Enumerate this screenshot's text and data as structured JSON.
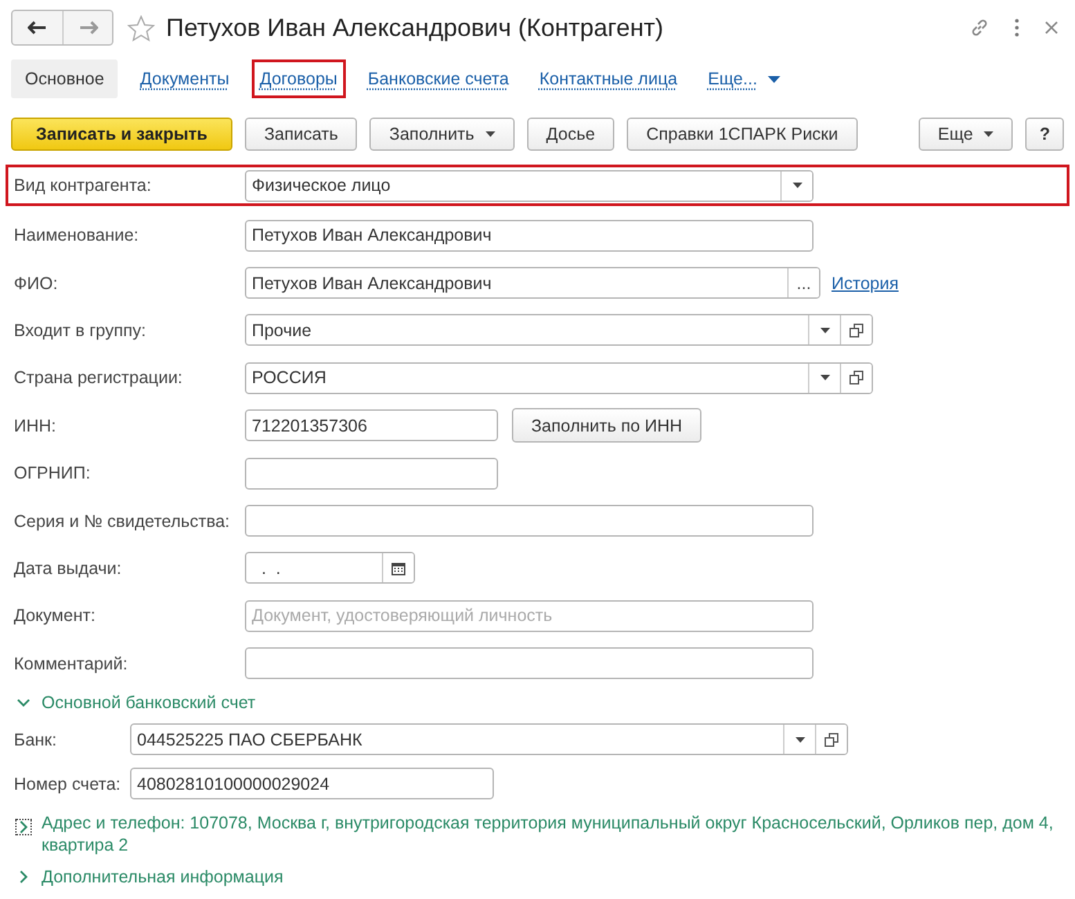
{
  "window": {
    "title": "Петухов Иван Александрович (Контрагент)"
  },
  "tabs": [
    {
      "label": "Основное",
      "selected": true,
      "highlighted": false,
      "kind": "tab"
    },
    {
      "label": "Документы",
      "selected": false,
      "highlighted": false,
      "kind": "tab"
    },
    {
      "label": "Договоры",
      "selected": false,
      "highlighted": true,
      "kind": "tab"
    },
    {
      "label": "Банковские счета",
      "selected": false,
      "highlighted": false,
      "kind": "tab"
    },
    {
      "label": "Контактные лица",
      "selected": false,
      "highlighted": false,
      "kind": "tab"
    },
    {
      "label": "Еще...",
      "selected": false,
      "highlighted": false,
      "kind": "more"
    }
  ],
  "toolbar": {
    "left": [
      {
        "label": "Записать и закрыть",
        "kind": "primary"
      },
      {
        "label": "Записать",
        "kind": "plain"
      },
      {
        "label": "Заполнить",
        "kind": "menu"
      },
      {
        "label": "Досье",
        "kind": "plain"
      },
      {
        "label": "Справки 1СПАРК Риски",
        "kind": "plain"
      }
    ],
    "right": [
      {
        "label": "Еще",
        "kind": "menu"
      },
      {
        "label": "?",
        "kind": "help"
      }
    ]
  },
  "fields": [
    {
      "label": "Вид контрагента:",
      "value": "Физическое лицо",
      "kind": "dropdown",
      "highlighted": true
    },
    {
      "label": "Наименование:",
      "value": "Петухов Иван Александрович",
      "kind": "text",
      "highlighted": false
    },
    {
      "label": "ФИО:",
      "value": "Петухов Иван Александрович",
      "kind": "choice",
      "button": "...",
      "link": "История",
      "highlighted": false
    },
    {
      "label": "Входит в группу:",
      "value": "Прочие",
      "kind": "dropdown-open",
      "highlighted": false
    },
    {
      "label": "Страна регистрации:",
      "value": "РОССИЯ",
      "kind": "dropdown-open",
      "highlighted": false
    },
    {
      "label": "ИНН:",
      "value": "712201357306",
      "kind": "short",
      "button": "Заполнить по ИНН",
      "highlighted": false
    },
    {
      "label": "ОГРНИП:",
      "kind": "short",
      "highlighted": false
    },
    {
      "label": "Серия и № свидетельства:",
      "kind": "text",
      "highlighted": false
    },
    {
      "label": "Дата выдачи:",
      "value": "  .  .",
      "kind": "date",
      "highlighted": false
    },
    {
      "label": "Документ:",
      "placeholder": "Документ, удостоверяющий личность",
      "kind": "text",
      "highlighted": false
    },
    {
      "label": "Комментарий:",
      "kind": "text",
      "highlighted": false
    }
  ],
  "bank_section": {
    "title": "Основной банковский счет",
    "expanded": true,
    "fields": [
      {
        "label": "Банк:",
        "value": "044525225 ПАО СБЕРБАНК",
        "kind": "dropdown-open"
      },
      {
        "label": "Номер счета:",
        "value": "40802810100000029024",
        "kind": "short"
      }
    ]
  },
  "groups": [
    {
      "title": "Адрес и телефон: 107078, Москва г, внутригородская территория муниципальный округ Красносельский, Орликов пер, дом 4, квартира 2",
      "expanded": false,
      "focused": true
    },
    {
      "title": "Дополнительная информация",
      "expanded": false,
      "focused": false
    }
  ]
}
